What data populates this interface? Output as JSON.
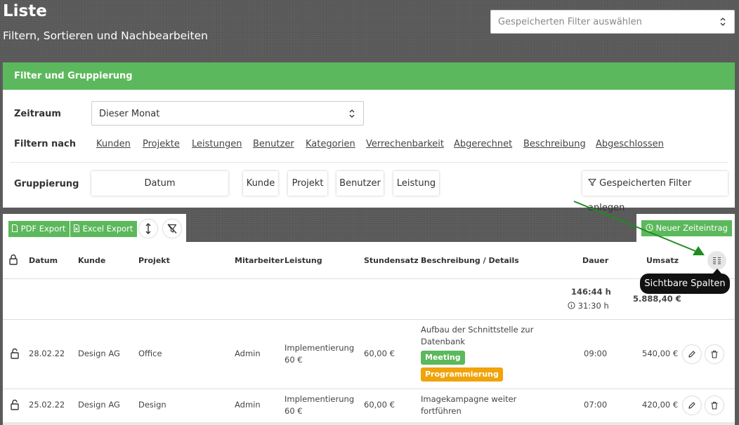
{
  "header": {
    "title": "Liste",
    "subtitle": "Filtern, Sortieren und Nachbearbeiten",
    "saved_filter_placeholder": "Gespeicherten Filter auswählen"
  },
  "filter_panel": {
    "title": "Filter und Gruppierung",
    "zeitraum_label": "Zeitraum",
    "zeitraum_value": "Dieser Monat",
    "filter_label": "Filtern nach",
    "filter_links": [
      "Kunden",
      "Projekte",
      "Leistungen",
      "Benutzer",
      "Kategorien",
      "Verrechenbarkeit",
      "Abgerechnet",
      "Beschreibung",
      "Abgeschlossen"
    ],
    "grouping_label": "Gruppierung",
    "grouping_buttons": [
      "Datum",
      "Kunde",
      "Projekt",
      "Benutzer",
      "Leistung"
    ],
    "save_filter_label": "Gespeicherten Filter anlegen"
  },
  "toolbar": {
    "pdf_export": "PDF Export",
    "excel_export": "Excel Export",
    "new_entry": "Neuer Zeiteintrag"
  },
  "table": {
    "columns": [
      "Datum",
      "Kunde",
      "Projekt",
      "Mitarbeiter",
      "Leistung",
      "Stundensatz",
      "Beschreibung / Details",
      "Dauer",
      "Umsatz"
    ],
    "summary": {
      "total_duration": "146:44 h",
      "billable_duration": "31:30 h",
      "total_revenue": "5.888,40 €"
    },
    "rows": [
      {
        "datum": "28.02.22",
        "kunde": "Design AG",
        "projekt": "Office",
        "mitarbeiter": "Admin",
        "leistung_line1": "Implementierung",
        "leistung_line2": "60 €",
        "stundensatz": "60,00 €",
        "beschreibung_line1": "Aufbau der Schnittstelle zur",
        "beschreibung_line2": "Datenbank",
        "badges": [
          "Meeting",
          "Programmierung"
        ],
        "dauer": "09:00",
        "umsatz": "540,00 €"
      },
      {
        "datum": "25.02.22",
        "kunde": "Design AG",
        "projekt": "Design",
        "mitarbeiter": "Admin",
        "leistung_line1": "Implementierung",
        "leistung_line2": "60 €",
        "stundensatz": "60,00 €",
        "beschreibung_line1": "Imagekampagne weiter",
        "beschreibung_line2": "fortführen",
        "badges": [],
        "dauer": "07:00",
        "umsatz": "420,00 €"
      }
    ]
  },
  "tooltip": {
    "text": "Sichtbare Spalten"
  },
  "colors": {
    "green": "#5cb85c",
    "badge_meeting": "#5cb85c",
    "badge_programmierung": "#f0a30a",
    "arrow": "#1e8c1e"
  }
}
